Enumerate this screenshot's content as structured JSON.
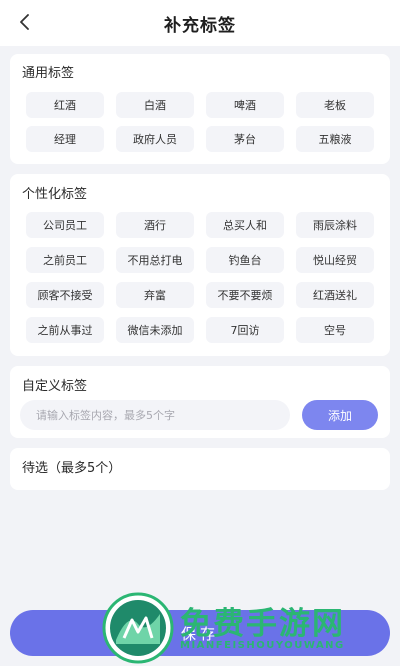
{
  "header": {
    "title": "补充标签"
  },
  "common_tags": {
    "title": "通用标签",
    "items": [
      "红酒",
      "白酒",
      "啤酒",
      "老板",
      "经理",
      "政府人员",
      "茅台",
      "五粮液"
    ]
  },
  "personal_tags": {
    "title": "个性化标签",
    "items": [
      "公司员工",
      "酒行",
      "总买人和",
      "雨辰涂料",
      "之前员工",
      "不用总打电",
      "钓鱼台",
      "悦山经贸",
      "顾客不接受",
      "弃富",
      "不要不要烦",
      "红酒送礼",
      "之前从事过",
      "微信未添加",
      "7回访",
      "空号"
    ]
  },
  "custom_tags": {
    "title": "自定义标签",
    "input_placeholder": "请输入标签内容，最多5个字",
    "input_value": "",
    "add_label": "添加"
  },
  "pending": {
    "title": "待选（最多5个）"
  },
  "footer": {
    "save_label": "保存"
  },
  "watermark": {
    "text": "免费手游网",
    "sub": "MIANFEISHOUYOUWANG"
  },
  "colors": {
    "accent": "#6a72e8",
    "tag_bg": "#f3f4f8",
    "watermark": "#2bb673"
  }
}
